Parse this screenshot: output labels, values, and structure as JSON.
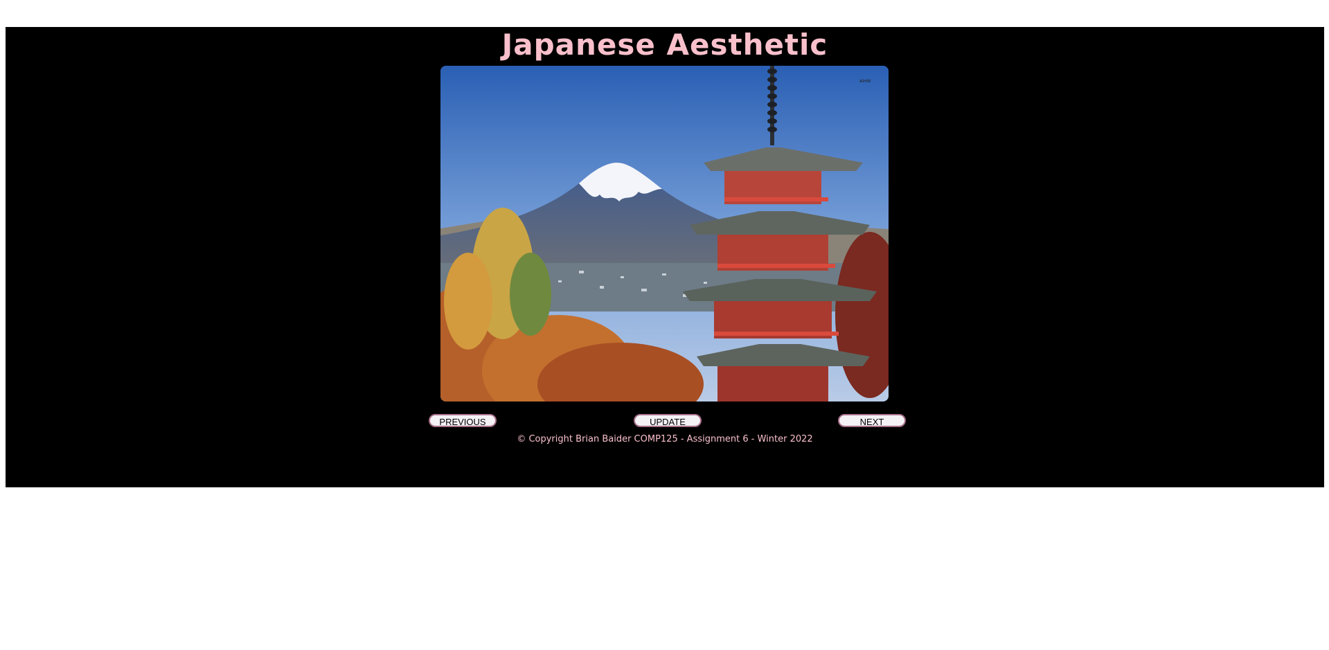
{
  "page": {
    "title": "Japanese Aesthetic",
    "image_alt": "Mount Fuji with Chureito pagoda in autumn",
    "image_watermark": "AIHW"
  },
  "controls": {
    "previous_label": "PREVIOUS",
    "update_label": "UPDATE",
    "next_label": "NEXT"
  },
  "footer": {
    "copyright": "© Copyright Brian Baider COMP125 - Assignment 6 - Winter 2022"
  },
  "colors": {
    "stage_background": "#000000",
    "title_color": "#f9c0cb",
    "button_border": "#a8708a"
  }
}
